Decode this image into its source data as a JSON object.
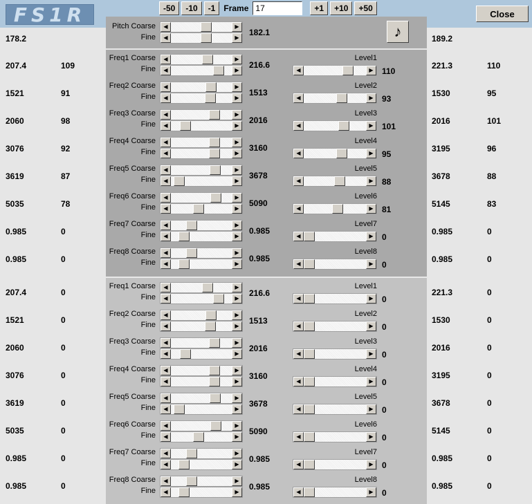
{
  "header": {
    "logo_text": "FS1R",
    "buttons_left": [
      "-50",
      "-10",
      "-1"
    ],
    "frame_label": "Frame",
    "frame_value": "17",
    "buttons_right": [
      "+1",
      "+10",
      "+50"
    ],
    "close_label": "Close"
  },
  "pitch": {
    "coarse_label": "Pitch Coarse",
    "fine_label": "Fine",
    "value": "182.1",
    "left_value": "178.2",
    "right_value": "189.2",
    "coarse_pos": 0.6,
    "fine_pos": 0.6,
    "note_icon": "♪"
  },
  "voiced": [
    {
      "label": "Freq1 Coarse",
      "fine": "Fine",
      "value": "216.6",
      "level_label": "Level1",
      "level": "110",
      "left_freq": "207.4",
      "left_level": "109",
      "right_freq": "221.3",
      "right_level": "110",
      "coarse_pos": 0.62,
      "fine_pos": 0.85,
      "level_pos": 0.75
    },
    {
      "label": "Freq2 Coarse",
      "fine": "Fine",
      "value": "1513",
      "level_label": "Level2",
      "level": "93",
      "left_freq": "1521",
      "left_level": "91",
      "right_freq": "1530",
      "right_level": "95",
      "coarse_pos": 0.7,
      "fine_pos": 0.68,
      "level_pos": 0.64
    },
    {
      "label": "Freq3 Coarse",
      "fine": "Fine",
      "value": "2016",
      "level_label": "Level3",
      "level": "101",
      "left_freq": "2060",
      "left_level": "98",
      "right_freq": "2016",
      "right_level": "101",
      "coarse_pos": 0.76,
      "fine_pos": 0.18,
      "level_pos": 0.68
    },
    {
      "label": "Freq4 Coarse",
      "fine": "Fine",
      "value": "3160",
      "level_label": "Level4",
      "level": "95",
      "left_freq": "3076",
      "left_level": "92",
      "right_freq": "3195",
      "right_level": "96",
      "coarse_pos": 0.76,
      "fine_pos": 0.76,
      "level_pos": 0.64
    },
    {
      "label": "Freq5 Coarse",
      "fine": "Fine",
      "value": "3678",
      "level_label": "Level5",
      "level": "88",
      "left_freq": "3619",
      "left_level": "87",
      "right_freq": "3678",
      "right_level": "88",
      "coarse_pos": 0.78,
      "fine_pos": 0.06,
      "level_pos": 0.6
    },
    {
      "label": "Freq6 Coarse",
      "fine": "Fine",
      "value": "5090",
      "level_label": "Level6",
      "level": "81",
      "left_freq": "5035",
      "left_level": "78",
      "right_freq": "5145",
      "right_level": "83",
      "coarse_pos": 0.79,
      "fine_pos": 0.45,
      "level_pos": 0.56
    },
    {
      "label": "Freq7 Coarse",
      "fine": "Fine",
      "value": "0.985",
      "level_label": "Level7",
      "level": "0",
      "left_freq": "0.985",
      "left_level": "0",
      "right_freq": "0.985",
      "right_level": "0",
      "coarse_pos": 0.3,
      "fine_pos": 0.15,
      "level_pos": 0.0
    },
    {
      "label": "Freq8 Coarse",
      "fine": "Fine",
      "value": "0.985",
      "level_label": "Level8",
      "level": "0",
      "left_freq": "0.985",
      "left_level": "0",
      "right_freq": "0.985",
      "right_level": "0",
      "coarse_pos": 0.3,
      "fine_pos": 0.15,
      "level_pos": 0.0
    }
  ],
  "unvoiced": [
    {
      "label": "Freq1 Coarse",
      "fine": "Fine",
      "value": "216.6",
      "level_label": "Level1",
      "level": "0",
      "left_freq": "207.4",
      "left_level": "0",
      "right_freq": "221.3",
      "right_level": "0",
      "coarse_pos": 0.62,
      "fine_pos": 0.85,
      "level_pos": 0.0
    },
    {
      "label": "Freq2 Coarse",
      "fine": "Fine",
      "value": "1513",
      "level_label": "Level2",
      "level": "0",
      "left_freq": "1521",
      "left_level": "0",
      "right_freq": "1530",
      "right_level": "0",
      "coarse_pos": 0.7,
      "fine_pos": 0.68,
      "level_pos": 0.0
    },
    {
      "label": "Freq3 Coarse",
      "fine": "Fine",
      "value": "2016",
      "level_label": "Level3",
      "level": "0",
      "left_freq": "2060",
      "left_level": "0",
      "right_freq": "2016",
      "right_level": "0",
      "coarse_pos": 0.76,
      "fine_pos": 0.18,
      "level_pos": 0.0
    },
    {
      "label": "Freq4 Coarse",
      "fine": "Fine",
      "value": "3160",
      "level_label": "Level4",
      "level": "0",
      "left_freq": "3076",
      "left_level": "0",
      "right_freq": "3195",
      "right_level": "0",
      "coarse_pos": 0.76,
      "fine_pos": 0.76,
      "level_pos": 0.0
    },
    {
      "label": "Freq5 Coarse",
      "fine": "Fine",
      "value": "3678",
      "level_label": "Level5",
      "level": "0",
      "left_freq": "3619",
      "left_level": "0",
      "right_freq": "3678",
      "right_level": "0",
      "coarse_pos": 0.78,
      "fine_pos": 0.06,
      "level_pos": 0.0
    },
    {
      "label": "Freq6 Coarse",
      "fine": "Fine",
      "value": "5090",
      "level_label": "Level6",
      "level": "0",
      "left_freq": "5035",
      "left_level": "0",
      "right_freq": "5145",
      "right_level": "0",
      "coarse_pos": 0.79,
      "fine_pos": 0.45,
      "level_pos": 0.0
    },
    {
      "label": "Freq7 Coarse",
      "fine": "Fine",
      "value": "0.985",
      "level_label": "Level7",
      "level": "0",
      "left_freq": "0.985",
      "left_level": "0",
      "right_freq": "0.985",
      "right_level": "0",
      "coarse_pos": 0.3,
      "fine_pos": 0.15,
      "level_pos": 0.0
    },
    {
      "label": "Freq8 Coarse",
      "fine": "Fine",
      "value": "0.985",
      "level_label": "Level8",
      "level": "0",
      "left_freq": "0.985",
      "left_level": "0",
      "right_freq": "0.985",
      "right_level": "0",
      "coarse_pos": 0.3,
      "fine_pos": 0.15,
      "level_pos": 0.0
    }
  ]
}
